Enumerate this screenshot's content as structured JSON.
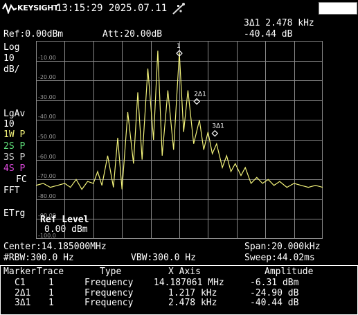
{
  "header": {
    "brand": "KEYSIGHT",
    "datetime": "13:15:29 2025.07.11",
    "marker_readout_freq": "3Δ1 2.478 kHz",
    "marker_readout_amp": "-40.44 dB",
    "ref": "Ref:0.00dBm",
    "att": "Att:20.00dB",
    "icons": {
      "logo": "keysight-logo-icon",
      "usb": "usb-icon"
    }
  },
  "left_panel": {
    "scale_type": "Log",
    "scale_value": "10",
    "scale_unit": "dB/",
    "avg_type": "LgAv",
    "avg_count": "10",
    "traces": [
      {
        "label": "1W P",
        "color": "#f2f27a"
      },
      {
        "label": "2S P",
        "color": "#5fe07a"
      },
      {
        "label": "3S P",
        "color": "#d8d8d8"
      },
      {
        "label": "4S P",
        "color": "#e24be2"
      }
    ],
    "fc": "FC",
    "fft": "FFT",
    "etrg": "ETrg"
  },
  "y_axis": {
    "ticks": [
      "-10.00",
      "-20.00",
      "-30.00",
      "-40.00",
      "-50.00",
      "-60.00",
      "-70.00",
      "-80.00",
      "-90.00",
      "-100.0"
    ]
  },
  "ref_level": {
    "title": "Ref Level",
    "value": "0.00 dBm"
  },
  "markers_on_plot": [
    "1",
    "2Δ1",
    "3Δ1"
  ],
  "bottom_info": {
    "center": "Center:14.185000MHz",
    "span": "Span:20.000kHz",
    "rbw": "#RBW:300.0 Hz",
    "vbw": "VBW:300.0 Hz",
    "sweep": "Sweep:44.02ms"
  },
  "marker_table": {
    "headers": [
      "Marker",
      "Trace",
      "Type",
      "X Axis",
      "Amplitude"
    ],
    "rows": [
      {
        "marker": "C1",
        "trace": "1",
        "type": "Frequency",
        "x": "14.187061 MHz",
        "amp": "-6.31 dBm"
      },
      {
        "marker": "2Δ1",
        "trace": "1",
        "type": "Frequency",
        "x": "1.217 kHz",
        "amp": "-24.90 dB"
      },
      {
        "marker": "3Δ1",
        "trace": "1",
        "type": "Frequency",
        "x": "2.478 kHz",
        "amp": "-40.44 dB"
      }
    ]
  },
  "colors": {
    "trace": "#f2f27a",
    "grid": "#8a8a8a",
    "background": "#000000"
  },
  "chart_data": {
    "type": "line",
    "x_range": [
      "14.175000 MHz",
      "14.195000 MHz"
    ],
    "ylim": [
      -100,
      0
    ],
    "grid": true,
    "series": [
      {
        "x_khz_offset": [
          -10,
          -9.5,
          -9,
          -8.5,
          -8,
          -7.6,
          -7.2,
          -6.8,
          -6.4,
          -6.0,
          -5.7,
          -5.4,
          -5.0,
          -4.6,
          -4.3,
          -4.0,
          -3.6,
          -3.2,
          -2.9,
          -2.6,
          -2.2,
          -1.8,
          -1.5,
          -1.2,
          -0.8,
          -0.4,
          0.0,
          0.3,
          0.6,
          1.0,
          1.4,
          1.7,
          2.0,
          2.3,
          2.6,
          3.0,
          3.3,
          3.6,
          3.9,
          4.3,
          4.6,
          5.0,
          5.4,
          5.8,
          6.2,
          6.6,
          7.0,
          7.5,
          8.0,
          8.5,
          9.0,
          9.5,
          10
        ],
        "y_dbm": [
          -73,
          -72,
          -74,
          -73,
          -72,
          -74,
          -70,
          -75,
          -71,
          -72,
          -66,
          -73,
          -58,
          -74,
          -49,
          -75,
          -36,
          -62,
          -26,
          -60,
          -14,
          -50,
          -5,
          -58,
          -25,
          -55,
          -6,
          -46,
          -25,
          -52,
          -40,
          -55,
          -46,
          -57,
          -52,
          -64,
          -58,
          -66,
          -62,
          -68,
          -64,
          -72,
          -69,
          -72,
          -70,
          -73,
          -71,
          -74,
          -72,
          -73,
          -74,
          -73,
          -74
        ]
      }
    ]
  }
}
